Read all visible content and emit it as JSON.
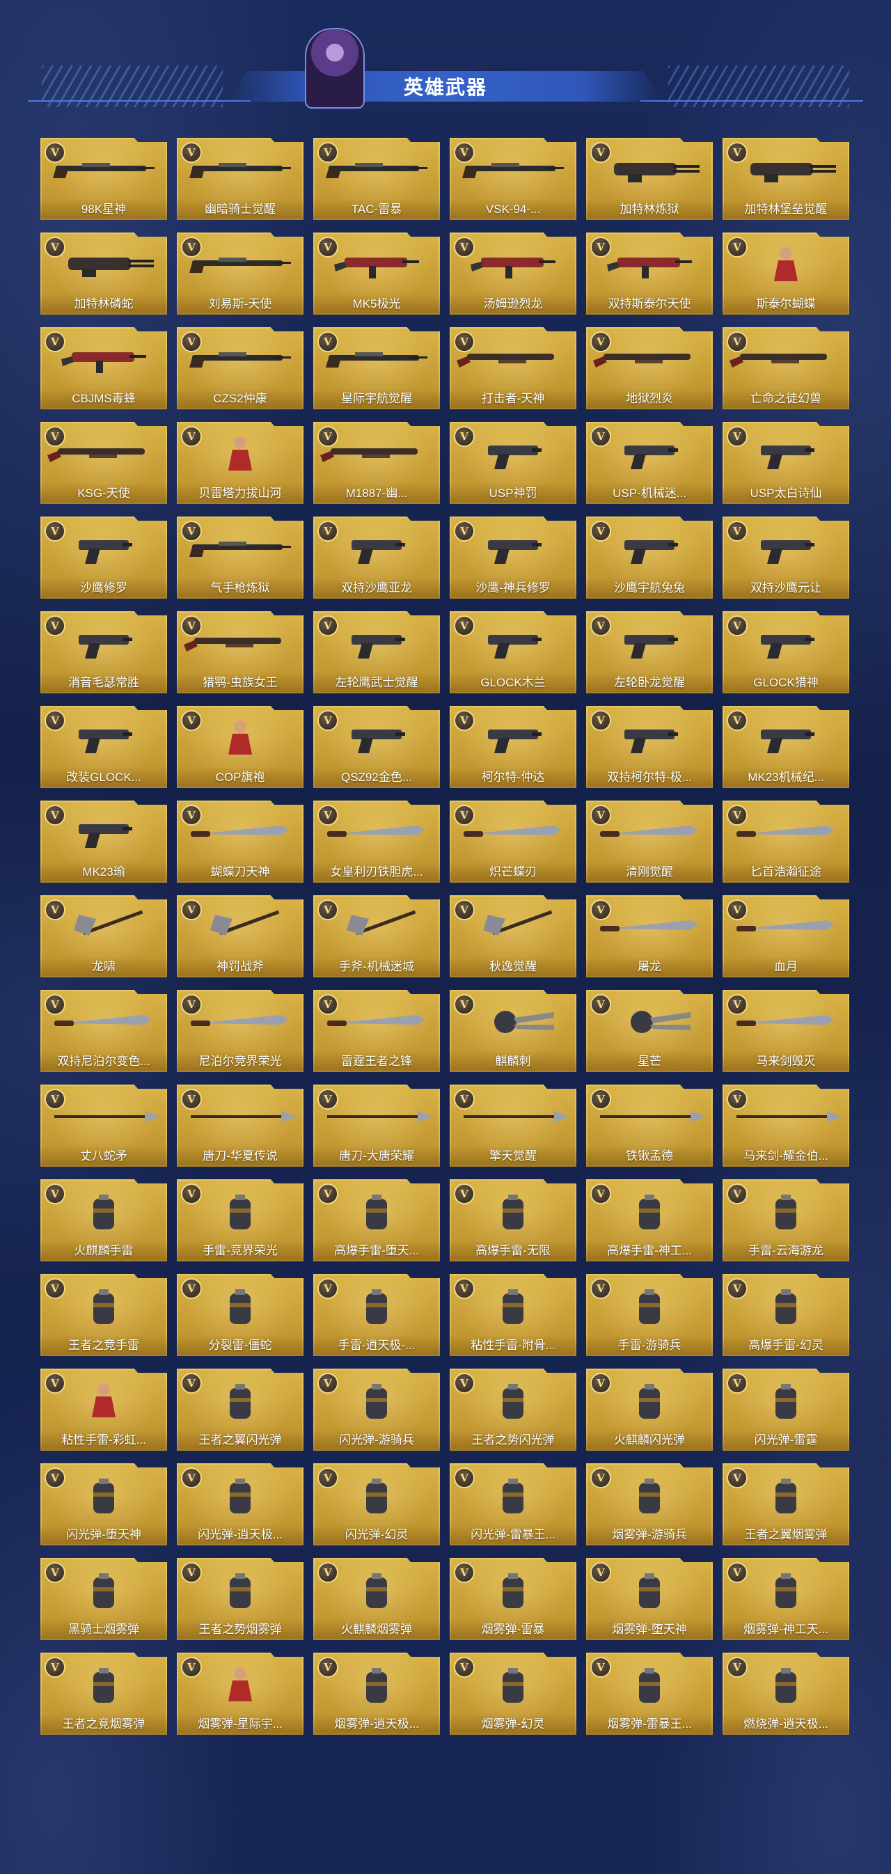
{
  "header": {
    "title": "英雄武器"
  },
  "badge_text": "V",
  "colors": {
    "tile_gold": "#c89e36",
    "badge_border": "#f0d98a",
    "background": "#15214a"
  },
  "items": [
    {
      "label": "98K星神",
      "icon": "rifle"
    },
    {
      "label": "幽暗骑士觉醒",
      "icon": "rifle"
    },
    {
      "label": "TAC-雷暴",
      "icon": "rifle"
    },
    {
      "label": "VSK-94-...",
      "icon": "rifle"
    },
    {
      "label": "加特林炼狱",
      "icon": "gatling"
    },
    {
      "label": "加特林堡垒觉醒",
      "icon": "gatling"
    },
    {
      "label": "加特林磷蛇",
      "icon": "gatling"
    },
    {
      "label": "刘易斯-天使",
      "icon": "rifle"
    },
    {
      "label": "MK5极光",
      "icon": "smg"
    },
    {
      "label": "汤姆逊烈龙",
      "icon": "smg"
    },
    {
      "label": "双持斯泰尔天使",
      "icon": "smg"
    },
    {
      "label": "斯泰尔蝴蝶",
      "icon": "figure"
    },
    {
      "label": "CBJMS毒蜂",
      "icon": "smg"
    },
    {
      "label": "CZS2仲康",
      "icon": "rifle"
    },
    {
      "label": "星际宇航觉醒",
      "icon": "rifle"
    },
    {
      "label": "打击者-天神",
      "icon": "shotgun"
    },
    {
      "label": "地狱烈炎",
      "icon": "shotgun"
    },
    {
      "label": "亡命之徒幻兽",
      "icon": "shotgun"
    },
    {
      "label": "KSG-天使",
      "icon": "shotgun"
    },
    {
      "label": "贝雷塔力拔山河",
      "icon": "figure"
    },
    {
      "label": "M1887-幽...",
      "icon": "shotgun"
    },
    {
      "label": "USP神罚",
      "icon": "pistol"
    },
    {
      "label": "USP-机械迷...",
      "icon": "pistol"
    },
    {
      "label": "USP太白诗仙",
      "icon": "pistol"
    },
    {
      "label": "沙鹰修罗",
      "icon": "pistol"
    },
    {
      "label": "气手枪炼狱",
      "icon": "rifle"
    },
    {
      "label": "双持沙鹰亚龙",
      "icon": "pistol"
    },
    {
      "label": "沙鹰-神兵修罗",
      "icon": "pistol"
    },
    {
      "label": "沙鹰宇航兔兔",
      "icon": "pistol"
    },
    {
      "label": "双持沙鹰元让",
      "icon": "pistol"
    },
    {
      "label": "消音毛瑟常胜",
      "icon": "pistol"
    },
    {
      "label": "猎鹗-虫族女王",
      "icon": "shotgun"
    },
    {
      "label": "左轮鹰武士觉醒",
      "icon": "pistol"
    },
    {
      "label": "GLOCK木兰",
      "icon": "pistol"
    },
    {
      "label": "左轮卧龙觉醒",
      "icon": "pistol"
    },
    {
      "label": "GLOCK猎神",
      "icon": "pistol"
    },
    {
      "label": "改装GLOCK...",
      "icon": "pistol"
    },
    {
      "label": "COP旗袍",
      "icon": "figure"
    },
    {
      "label": "QSZ92金色...",
      "icon": "pistol"
    },
    {
      "label": "柯尔特-仲达",
      "icon": "pistol"
    },
    {
      "label": "双持柯尔特-极...",
      "icon": "pistol"
    },
    {
      "label": "MK23机械纪...",
      "icon": "pistol"
    },
    {
      "label": "MK23瑜",
      "icon": "pistol"
    },
    {
      "label": "蝴蝶刀天神",
      "icon": "blade"
    },
    {
      "label": "女皇利刃铁胆虎...",
      "icon": "blade"
    },
    {
      "label": "炽芒蝶刃",
      "icon": "blade"
    },
    {
      "label": "清刚觉醒",
      "icon": "blade"
    },
    {
      "label": "匕首浩瀚征途",
      "icon": "blade"
    },
    {
      "label": "龙啸",
      "icon": "axe"
    },
    {
      "label": "神罚战斧",
      "icon": "axe"
    },
    {
      "label": "手斧-机械迷城",
      "icon": "axe"
    },
    {
      "label": "秋逸觉醒",
      "icon": "axe"
    },
    {
      "label": "屠龙",
      "icon": "blade"
    },
    {
      "label": "血月",
      "icon": "blade"
    },
    {
      "label": "双持尼泊尔变色...",
      "icon": "blade"
    },
    {
      "label": "尼泊尔竞界荣光",
      "icon": "blade"
    },
    {
      "label": "雷霆王者之锋",
      "icon": "blade"
    },
    {
      "label": "麒麟刺",
      "icon": "claw"
    },
    {
      "label": "星芒",
      "icon": "claw"
    },
    {
      "label": "马来剑毁灭",
      "icon": "blade"
    },
    {
      "label": "丈八蛇矛",
      "icon": "spear"
    },
    {
      "label": "唐刀-华夏传说",
      "icon": "spear"
    },
    {
      "label": "唐刀-大唐荣耀",
      "icon": "spear"
    },
    {
      "label": "擎天觉醒",
      "icon": "spear"
    },
    {
      "label": "铁锹孟德",
      "icon": "spear"
    },
    {
      "label": "马来剑-耀金伯...",
      "icon": "spear"
    },
    {
      "label": "火麒麟手雷",
      "icon": "grenade"
    },
    {
      "label": "手雷-竞界荣光",
      "icon": "grenade"
    },
    {
      "label": "高爆手雷-堕天...",
      "icon": "grenade"
    },
    {
      "label": "高爆手雷-无限",
      "icon": "grenade"
    },
    {
      "label": "高爆手雷-神工...",
      "icon": "grenade"
    },
    {
      "label": "手雷-云海游龙",
      "icon": "grenade"
    },
    {
      "label": "王者之竞手雷",
      "icon": "grenade"
    },
    {
      "label": "分裂雷-僵蛇",
      "icon": "grenade"
    },
    {
      "label": "手雷-逍天极-...",
      "icon": "grenade"
    },
    {
      "label": "粘性手雷-附骨...",
      "icon": "grenade"
    },
    {
      "label": "手雷-游骑兵",
      "icon": "grenade"
    },
    {
      "label": "高爆手雷-幻灵",
      "icon": "grenade"
    },
    {
      "label": "粘性手雷-彩虹...",
      "icon": "figure"
    },
    {
      "label": "王者之翼闪光弹",
      "icon": "grenade"
    },
    {
      "label": "闪光弹-游骑兵",
      "icon": "grenade"
    },
    {
      "label": "王者之势闪光弹",
      "icon": "grenade"
    },
    {
      "label": "火麒麟闪光弹",
      "icon": "grenade"
    },
    {
      "label": "闪光弹-雷霆",
      "icon": "grenade"
    },
    {
      "label": "闪光弹-堕天神",
      "icon": "grenade"
    },
    {
      "label": "闪光弹-逍天极...",
      "icon": "grenade"
    },
    {
      "label": "闪光弹-幻灵",
      "icon": "grenade"
    },
    {
      "label": "闪光弹-雷暴王...",
      "icon": "grenade"
    },
    {
      "label": "烟雾弹-游骑兵",
      "icon": "grenade"
    },
    {
      "label": "王者之翼烟雾弹",
      "icon": "grenade"
    },
    {
      "label": "黑骑士烟雾弹",
      "icon": "grenade"
    },
    {
      "label": "王者之势烟雾弹",
      "icon": "grenade"
    },
    {
      "label": "火麒麟烟雾弹",
      "icon": "grenade"
    },
    {
      "label": "烟雾弹-雷暴",
      "icon": "grenade"
    },
    {
      "label": "烟雾弹-堕天神",
      "icon": "grenade"
    },
    {
      "label": "烟雾弹-神工天...",
      "icon": "grenade"
    },
    {
      "label": "王者之竞烟雾弹",
      "icon": "grenade"
    },
    {
      "label": "烟雾弹-星际宇...",
      "icon": "figure"
    },
    {
      "label": "烟雾弹-逍天极...",
      "icon": "grenade"
    },
    {
      "label": "烟雾弹-幻灵",
      "icon": "grenade"
    },
    {
      "label": "烟雾弹-雷暴王...",
      "icon": "grenade"
    },
    {
      "label": "燃烧弹-逍天极...",
      "icon": "grenade"
    }
  ]
}
